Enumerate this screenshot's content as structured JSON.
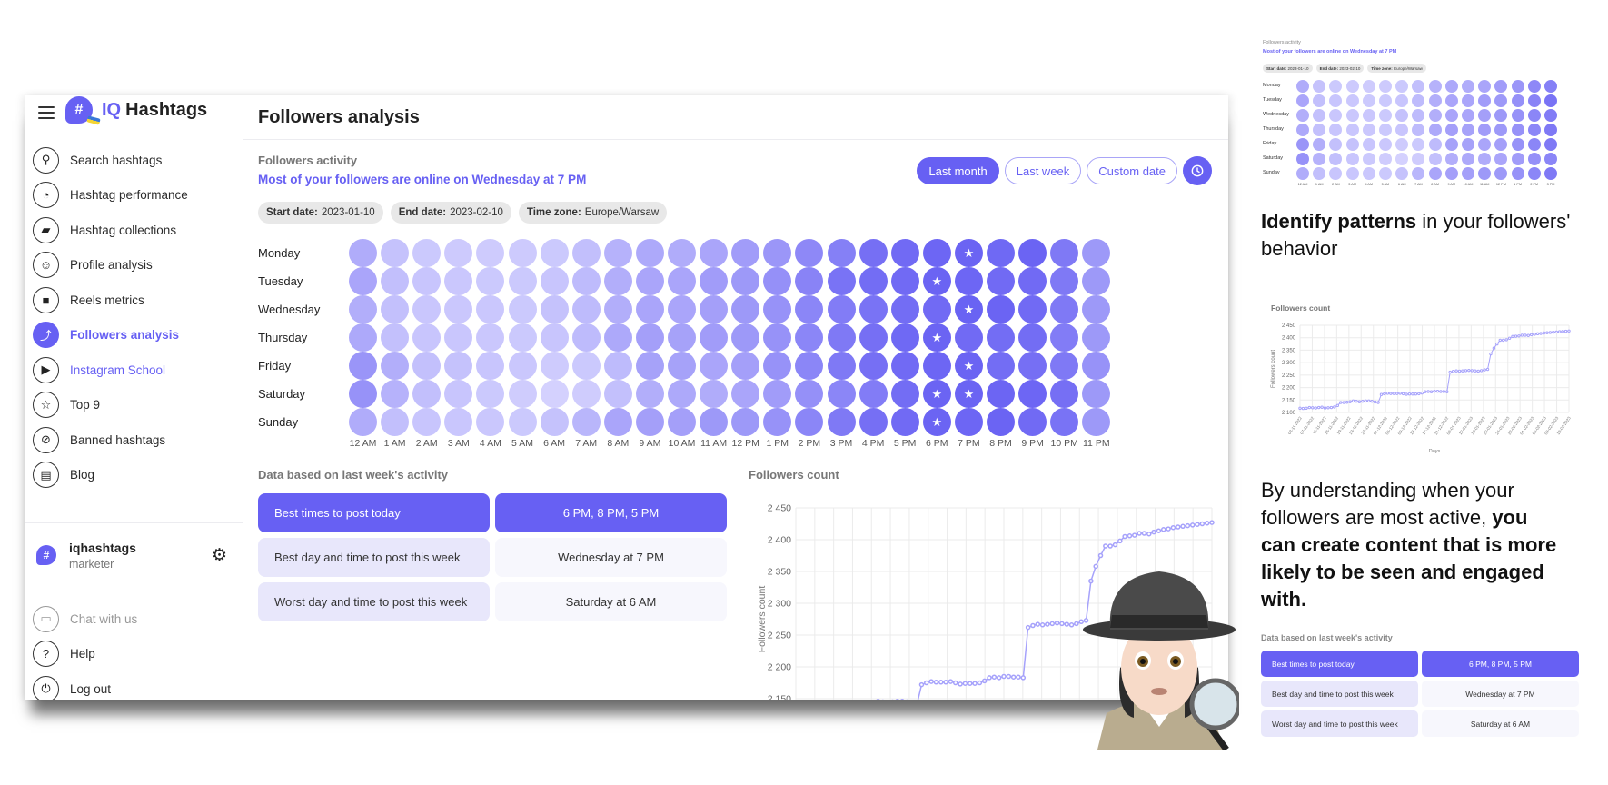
{
  "brand": {
    "iq": "IQ",
    "name": "Hashtags",
    "mark": "#",
    "accent": "#6760f3"
  },
  "sidebar": {
    "items": [
      {
        "label": "Search hashtags",
        "icon": "search-icon"
      },
      {
        "label": "Hashtag performance",
        "icon": "gauge-icon"
      },
      {
        "label": "Hashtag collections",
        "icon": "folder-star-icon"
      },
      {
        "label": "Profile analysis",
        "icon": "face-icon"
      },
      {
        "label": "Reels metrics",
        "icon": "video-camera-icon"
      },
      {
        "label": "Followers analysis",
        "icon": "trend-icon",
        "active": true
      },
      {
        "label": "Instagram School",
        "icon": "play-message-icon"
      },
      {
        "label": "Top 9",
        "icon": "star-badge-icon"
      },
      {
        "label": "Banned hashtags",
        "icon": "ban-icon"
      },
      {
        "label": "Blog",
        "icon": "document-icon"
      }
    ],
    "user": {
      "name": "iqhashtags",
      "role": "marketer",
      "badge": "#"
    },
    "bottom_items": [
      {
        "label": "Chat with us",
        "icon": "chat-icon"
      },
      {
        "label": "Help",
        "icon": "help-icon"
      },
      {
        "label": "Log out",
        "icon": "power-icon"
      }
    ]
  },
  "main": {
    "title": "Followers analysis",
    "activity_label": "Followers activity",
    "headline": "Most of your followers are online on Wednesday at 7 PM",
    "range_buttons": [
      {
        "label": "Last month",
        "active": true
      },
      {
        "label": "Last week",
        "active": false
      },
      {
        "label": "Custom date",
        "active": false
      }
    ],
    "chips": [
      {
        "key": "Start date:",
        "value": "2023-01-10"
      },
      {
        "key": "End date:",
        "value": "2023-02-10"
      },
      {
        "key": "Time zone:",
        "value": "Europe/Warsaw"
      }
    ],
    "insights_label": "Data based on last week's activity",
    "insights": [
      {
        "key": "Best times to post today",
        "value": "6 PM, 8 PM, 5 PM",
        "highlight": true
      },
      {
        "key": "Best day and time to post this week",
        "value": "Wednesday at 7 PM",
        "highlight": false
      },
      {
        "key": "Worst day and time to post this week",
        "value": "Saturday at 6 AM",
        "highlight": false
      }
    ],
    "chart_title": "Followers count"
  },
  "chart_data": [
    {
      "type": "heatmap",
      "title": "Followers activity",
      "rows": [
        "Monday",
        "Tuesday",
        "Wednesday",
        "Thursday",
        "Friday",
        "Saturday",
        "Sunday"
      ],
      "columns": [
        "12 AM",
        "1 AM",
        "2 AM",
        "3 AM",
        "4 AM",
        "5 AM",
        "6 AM",
        "7 AM",
        "8 AM",
        "9 AM",
        "10 AM",
        "11 AM",
        "12 PM",
        "1 PM",
        "2 PM",
        "3 PM",
        "4 PM",
        "5 PM",
        "6 PM",
        "7 PM",
        "8 PM",
        "9 PM",
        "10 PM",
        "11 PM"
      ],
      "intensity_scale": [
        0,
        1
      ],
      "values": [
        [
          0.4,
          0.22,
          0.17,
          0.16,
          0.15,
          0.16,
          0.17,
          0.25,
          0.35,
          0.42,
          0.4,
          0.45,
          0.52,
          0.57,
          0.68,
          0.75,
          0.88,
          0.92,
          0.95,
          0.97,
          0.93,
          0.97,
          0.8,
          0.55
        ],
        [
          0.45,
          0.25,
          0.2,
          0.18,
          0.17,
          0.17,
          0.2,
          0.28,
          0.38,
          0.45,
          0.45,
          0.52,
          0.55,
          0.62,
          0.72,
          0.85,
          0.9,
          0.92,
          0.97,
          0.95,
          0.92,
          0.92,
          0.8,
          0.55
        ],
        [
          0.38,
          0.24,
          0.19,
          0.18,
          0.18,
          0.17,
          0.22,
          0.28,
          0.38,
          0.45,
          0.45,
          0.5,
          0.55,
          0.6,
          0.7,
          0.78,
          0.85,
          0.9,
          0.92,
          0.98,
          0.97,
          0.92,
          0.8,
          0.55
        ],
        [
          0.42,
          0.24,
          0.2,
          0.19,
          0.18,
          0.17,
          0.2,
          0.28,
          0.42,
          0.5,
          0.48,
          0.52,
          0.55,
          0.6,
          0.7,
          0.8,
          0.88,
          0.93,
          0.97,
          0.92,
          0.9,
          0.9,
          0.78,
          0.55
        ],
        [
          0.58,
          0.38,
          0.24,
          0.22,
          0.2,
          0.18,
          0.15,
          0.17,
          0.28,
          0.48,
          0.48,
          0.45,
          0.5,
          0.6,
          0.7,
          0.8,
          0.88,
          0.92,
          0.95,
          0.97,
          0.9,
          0.88,
          0.8,
          0.6
        ],
        [
          0.6,
          0.35,
          0.25,
          0.2,
          0.17,
          0.14,
          0.1,
          0.14,
          0.24,
          0.38,
          0.42,
          0.4,
          0.45,
          0.52,
          0.62,
          0.7,
          0.78,
          0.9,
          0.97,
          0.97,
          0.96,
          0.95,
          0.88,
          0.55
        ],
        [
          0.4,
          0.25,
          0.2,
          0.19,
          0.18,
          0.17,
          0.22,
          0.32,
          0.45,
          0.5,
          0.5,
          0.55,
          0.55,
          0.6,
          0.7,
          0.8,
          0.88,
          0.92,
          0.97,
          0.95,
          0.97,
          0.92,
          0.85,
          0.55
        ]
      ],
      "stars": [
        {
          "row": "Monday",
          "col": "7 PM"
        },
        {
          "row": "Tuesday",
          "col": "6 PM"
        },
        {
          "row": "Wednesday",
          "col": "7 PM"
        },
        {
          "row": "Thursday",
          "col": "6 PM"
        },
        {
          "row": "Friday",
          "col": "7 PM"
        },
        {
          "row": "Saturday",
          "col": "6 PM"
        },
        {
          "row": "Saturday",
          "col": "7 PM"
        },
        {
          "row": "Sunday",
          "col": "6 PM"
        }
      ],
      "color_low": "#e0deff",
      "color_high": "#6760f3"
    },
    {
      "type": "line",
      "title": "Followers count",
      "ylabel": "Followers count",
      "xlabel": "Days",
      "ylim": [
        2100,
        2450
      ],
      "yticks": [
        2100,
        2150,
        2200,
        2250,
        2300,
        2350,
        2400,
        2450
      ],
      "ytick_labels": [
        "2 100",
        "2 150",
        "2 200",
        "2 250",
        "2 300",
        "2 350",
        "2 400",
        "2 450"
      ],
      "xtick_labels": [
        "03-11-2022",
        "07-11-2022",
        "11-11-2022",
        "15-11-2022",
        "19-11-2022",
        "23-11-2022",
        "27-11-2022",
        "01-12-2022",
        "05-12-2022",
        "09-12-2022",
        "13-12-2022",
        "17-12-2022",
        "21-12-2022",
        "08-01-2023",
        "12-01-2023",
        "16-01-2023",
        "20-01-2023",
        "24-01-2023",
        "28-01-2023",
        "01-02-2023",
        "05-02-2023",
        "09-02-2023",
        "13-02-2023"
      ],
      "grid": true,
      "color": "#a6a2fb",
      "values": [
        2117,
        2116,
        2117,
        2120,
        2119,
        2118,
        2120,
        2121,
        2118,
        2119,
        2120,
        2122,
        2128,
        2140,
        2140,
        2141,
        2143,
        2146,
        2145,
        2143,
        2145,
        2146,
        2146,
        2145,
        2142,
        2140,
        2172,
        2175,
        2177,
        2176,
        2176,
        2176,
        2177,
        2175,
        2173,
        2174,
        2174,
        2174,
        2175,
        2178,
        2183,
        2184,
        2183,
        2185,
        2185,
        2184,
        2184,
        2183,
        2262,
        2265,
        2267,
        2266,
        2267,
        2268,
        2269,
        2268,
        2267,
        2266,
        2268,
        2271,
        2273,
        2335,
        2358,
        2375,
        2390,
        2390,
        2392,
        2398,
        2405,
        2406,
        2407,
        2410,
        2410,
        2409,
        2412,
        2414,
        2416,
        2417,
        2419,
        2420,
        2421,
        2422,
        2423,
        2424,
        2425,
        2426,
        2427
      ]
    }
  ],
  "right_panel": {
    "text1_bold": "Identify patterns",
    "text1_rest": " in your followers' behavior",
    "text2_regular": "By understanding when your followers are most active, ",
    "text2_bold": "you can create content that is more likely to be seen and engaged with.",
    "mini_heatmap_columns": [
      "12 AM",
      "1 AM",
      "2 AM",
      "3 AM",
      "4 AM",
      "5 AM",
      "6 AM",
      "7 AM",
      "8 AM",
      "9 AM",
      "10 AM",
      "11 AM",
      "12 PM",
      "1 PM",
      "2 PM",
      "3 PM"
    ]
  }
}
